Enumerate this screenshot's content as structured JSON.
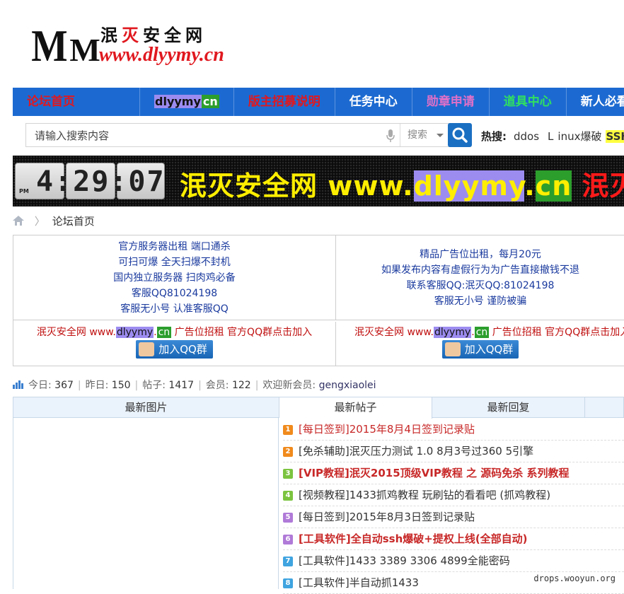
{
  "header": {
    "logo_mm_big": "M",
    "logo_mm_small": "M",
    "logo_cn_part1": "泯",
    "logo_cn_part2": "灭",
    "logo_cn_part3": "安全网",
    "logo_url": "www.dlyymy.cn"
  },
  "navbar": {
    "items": [
      {
        "label": "论坛首页",
        "color": "#e0181f"
      },
      {
        "label_a": "dlyymy",
        "label_b": "cn"
      },
      {
        "label": "版主招募说明",
        "color": "#e0181f"
      },
      {
        "label": "任务中心",
        "color": "#ffffff"
      },
      {
        "label": "勋章申请",
        "color": "#e070c8"
      },
      {
        "label": "道具中心",
        "color": "#30e060"
      },
      {
        "label": "新人必看",
        "color": "#ffffff"
      }
    ]
  },
  "search": {
    "placeholder": "请输入搜索内容",
    "type_label": "搜索",
    "hot_label": "热搜:",
    "hot_items": [
      "ddos",
      "L",
      "inux爆破",
      "SSH"
    ]
  },
  "banner": {
    "clock": "4:29:07",
    "clock_pm": "PM",
    "text_cn": "泯灭安全网",
    "text_www": " www.",
    "text_domain": "dlyymy",
    "text_dot": ".",
    "text_cn_tld": "cn",
    "text_cn2": "泯灭安全网"
  },
  "breadcrumb": {
    "home_icon": "home-icon",
    "current": "论坛首页"
  },
  "ads": {
    "left_lines": [
      "官方服务器出租 端口通杀",
      "可扫可爆 全天扫爆不封机",
      "国内独立服务器 扫肉鸡必备",
      "客服QQ81024198",
      "客服无小号 认准客服QQ"
    ],
    "right_lines": [
      "精品广告位出租，每月20元",
      "如果发布内容有虚假行为为广告直接撤钱不退",
      "联系客服QQ:泯灭QQ:81024198",
      "客服无小号 谨防被骗"
    ],
    "recruit_prefix": "泯灭安全网 www.",
    "recruit_domain": "dlyymy",
    "recruit_dot": ".",
    "recruit_tld": "cn",
    "recruit_suffix": " 广告位招租 官方QQ群点击加入",
    "qq_button": "加入QQ群"
  },
  "stats": {
    "today_label": "今日:",
    "today": "367",
    "yesterday_label": "昨日:",
    "yesterday": "150",
    "posts_label": "帖子:",
    "posts": "1417",
    "members_label": "会员:",
    "members": "122",
    "welcome_label": "欢迎新会员:",
    "new_member": "gengxiaolei"
  },
  "tabs": {
    "images": "最新图片",
    "posts": "最新帖子",
    "replies": "最新回复"
  },
  "threads": [
    {
      "num": "1",
      "badge_color": "#f08a1c",
      "text": "[每日签到]2015年8月4日签到记录贴",
      "color": "#c82828",
      "bold": false
    },
    {
      "num": "2",
      "badge_color": "#f08a1c",
      "text": "[免杀辅助]泯灭压力测试 1.0 8月3号过360 5引擎",
      "color": "#333333",
      "bold": false
    },
    {
      "num": "3",
      "badge_color": "#7cc440",
      "text": "[VIP教程]泯灭2015顶级VIP教程 之 源码免杀 系列教程",
      "color": "#c82828",
      "bold": true
    },
    {
      "num": "4",
      "badge_color": "#7cc440",
      "text": "[视频教程]1433抓鸡教程 玩刷钻的看看吧 (抓鸡教程)",
      "color": "#333333",
      "bold": false
    },
    {
      "num": "5",
      "badge_color": "#b07ad8",
      "text": "[每日签到]2015年8月3日签到记录贴",
      "color": "#333333",
      "bold": false
    },
    {
      "num": "6",
      "badge_color": "#b07ad8",
      "text": "[工具软件]全自动ssh爆破+提权上线(全部自动)",
      "color": "#c82828",
      "bold": true
    },
    {
      "num": "7",
      "badge_color": "#3fa4e0",
      "text": "[工具软件]1433 3389 3306 4899全能密码",
      "color": "#333333",
      "bold": false
    },
    {
      "num": "8",
      "badge_color": "#3fa4e0",
      "text": "[工具软件]半自动抓1433",
      "color": "#333333",
      "bold": false
    }
  ],
  "watermark": "drops.wooyun.org"
}
